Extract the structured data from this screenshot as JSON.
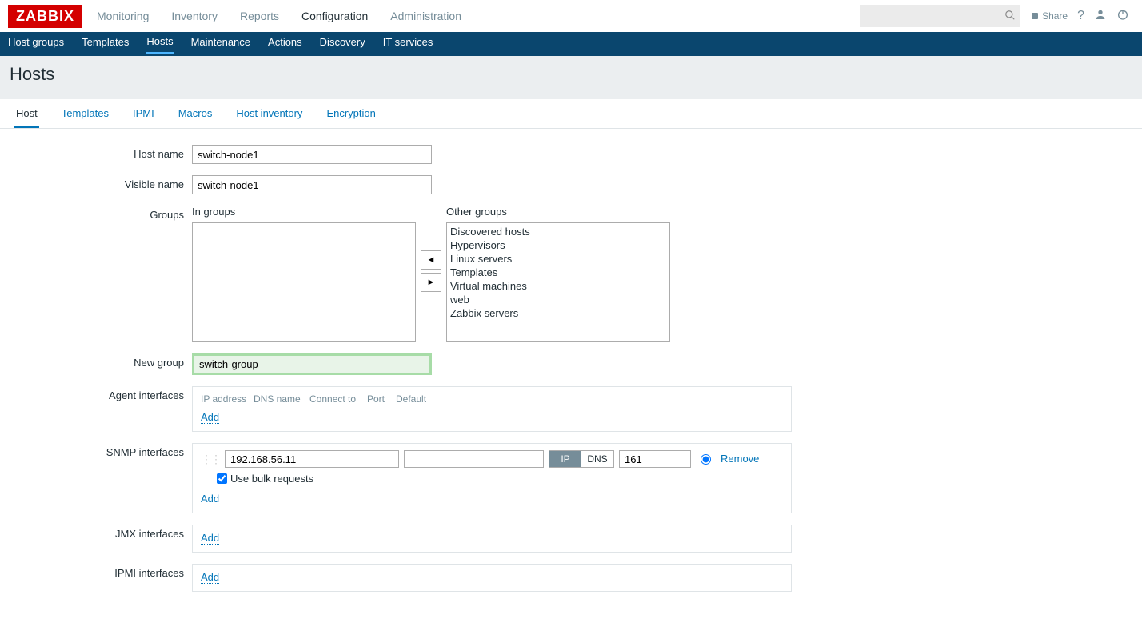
{
  "logo": "ZABBIX",
  "topnav": {
    "items": [
      "Monitoring",
      "Inventory",
      "Reports",
      "Configuration",
      "Administration"
    ],
    "active": 3
  },
  "top_right": {
    "share": "Share"
  },
  "subnav": {
    "items": [
      "Host groups",
      "Templates",
      "Hosts",
      "Maintenance",
      "Actions",
      "Discovery",
      "IT services"
    ],
    "active": 2
  },
  "page_title": "Hosts",
  "tabs": {
    "items": [
      "Host",
      "Templates",
      "IPMI",
      "Macros",
      "Host inventory",
      "Encryption"
    ],
    "active": 0
  },
  "form": {
    "host_name": {
      "label": "Host name",
      "value": "switch-node1"
    },
    "visible_name": {
      "label": "Visible name",
      "value": "switch-node1"
    },
    "groups": {
      "label": "Groups",
      "in_label": "In groups",
      "other_label": "Other groups",
      "in_items": [],
      "other_items": [
        "Discovered hosts",
        "Hypervisors",
        "Linux servers",
        "Templates",
        "Virtual machines",
        "web",
        "Zabbix servers"
      ]
    },
    "new_group": {
      "label": "New group",
      "value": "switch-group"
    },
    "agent_ifaces": {
      "label": "Agent interfaces",
      "headers": [
        "IP address",
        "DNS name",
        "Connect to",
        "Port",
        "Default"
      ],
      "add": "Add"
    },
    "snmp_ifaces": {
      "label": "SNMP interfaces",
      "row": {
        "ip": "192.168.56.11",
        "dns": "",
        "connect_ip": "IP",
        "connect_dns": "DNS",
        "port": "161",
        "remove": "Remove"
      },
      "bulk": "Use bulk requests",
      "add": "Add"
    },
    "jmx_ifaces": {
      "label": "JMX interfaces",
      "add": "Add"
    },
    "ipmi_ifaces": {
      "label": "IPMI interfaces",
      "add": "Add"
    }
  }
}
